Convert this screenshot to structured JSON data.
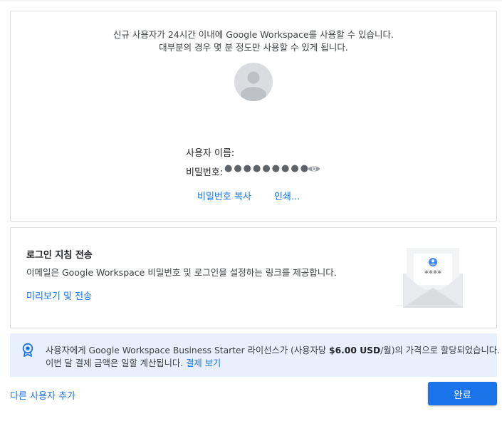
{
  "card1": {
    "message_line1": "신규 사용자가 24시간 이내에 Google Workspace를 사용할 수 있습니다.",
    "message_line2": "대부분의 경우 몇 분 정도만 사용할 수 있게 됩니다.",
    "username_label": "사용자 이름:",
    "password_label": "비밀번호:",
    "password_masked": "●●●●●●●●●",
    "copy_password_label": "비밀번호 복사",
    "print_label": "인쇄..."
  },
  "card2": {
    "title": "로그인 지침 전송",
    "description": "이메일은 Google Workspace 비밀번호 및 로그인을 설정하는 링크를 제공합니다.",
    "preview_send_label": "미리보기 및 전송",
    "envelope_stars": "****"
  },
  "banner": {
    "line1_prefix": "사용자에게 Google Workspace Business Starter 라이선스가 (사용자당 ",
    "line1_price": "$6.00 USD",
    "line1_suffix": "/월)의 가격으로 할당되었습니다.",
    "line2_text": "이번 달 결제 금액은 일할 계산됩니다. ",
    "line2_link": "결제 보기"
  },
  "footer": {
    "add_user_label": "다른 사용자 추가",
    "done_label": "완료"
  },
  "colors": {
    "accent": "#1a73e8",
    "banner_bg": "#e8f0fe",
    "border": "#dadce0"
  },
  "icons": [
    "avatar-icon",
    "eye-icon",
    "envelope-icon",
    "badge-icon"
  ]
}
